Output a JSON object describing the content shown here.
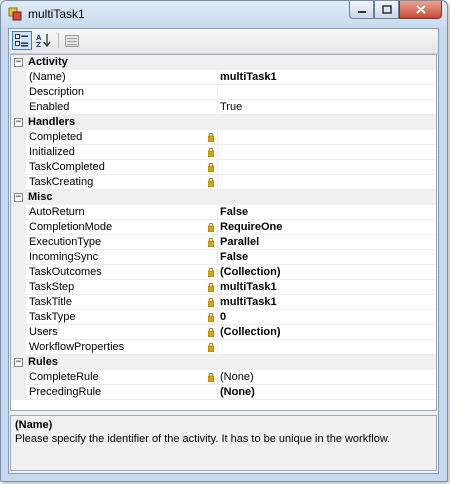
{
  "window": {
    "title": "multiTask1"
  },
  "toolbar": {
    "categorized_tooltip": "Categorized",
    "alphabetical_tooltip": "Alphabetical",
    "property_pages_tooltip": "Property Pages"
  },
  "categories": [
    {
      "name": "Activity",
      "expanded": true,
      "properties": [
        {
          "name": "(Name)",
          "value": "multiTask1",
          "bold": true,
          "locked": false
        },
        {
          "name": "Description",
          "value": "",
          "bold": false,
          "locked": false
        },
        {
          "name": "Enabled",
          "value": "True",
          "bold": false,
          "locked": false
        }
      ]
    },
    {
      "name": "Handlers",
      "expanded": true,
      "properties": [
        {
          "name": "Completed",
          "value": "",
          "bold": false,
          "locked": true
        },
        {
          "name": "Initialized",
          "value": "",
          "bold": false,
          "locked": true
        },
        {
          "name": "TaskCompleted",
          "value": "",
          "bold": false,
          "locked": true
        },
        {
          "name": "TaskCreating",
          "value": "",
          "bold": false,
          "locked": true
        }
      ]
    },
    {
      "name": "Misc",
      "expanded": true,
      "properties": [
        {
          "name": "AutoReturn",
          "value": "False",
          "bold": true,
          "locked": false
        },
        {
          "name": "CompletionMode",
          "value": "RequireOne",
          "bold": true,
          "locked": true
        },
        {
          "name": "ExecutionType",
          "value": "Parallel",
          "bold": true,
          "locked": true
        },
        {
          "name": "IncomingSync",
          "value": "False",
          "bold": true,
          "locked": false
        },
        {
          "name": "TaskOutcomes",
          "value": "(Collection)",
          "bold": true,
          "locked": true
        },
        {
          "name": "TaskStep",
          "value": "multiTask1",
          "bold": true,
          "locked": true
        },
        {
          "name": "TaskTitle",
          "value": "multiTask1",
          "bold": true,
          "locked": true
        },
        {
          "name": "TaskType",
          "value": "0",
          "bold": true,
          "locked": true
        },
        {
          "name": "Users",
          "value": "(Collection)",
          "bold": true,
          "locked": true
        },
        {
          "name": "WorkflowProperties",
          "value": "",
          "bold": false,
          "locked": true
        }
      ]
    },
    {
      "name": "Rules",
      "expanded": true,
      "properties": [
        {
          "name": "CompleteRule",
          "value": "(None)",
          "bold": false,
          "locked": true
        },
        {
          "name": "PrecedingRule",
          "value": "(None)",
          "bold": true,
          "locked": false
        }
      ]
    }
  ],
  "description": {
    "title": "(Name)",
    "text": "Please specify the identifier of the activity. It has to be unique in the workflow."
  },
  "colors": {
    "lock": "#d9a400",
    "category_bg": "#f0f0f0",
    "frame": "#c6d9ee"
  }
}
